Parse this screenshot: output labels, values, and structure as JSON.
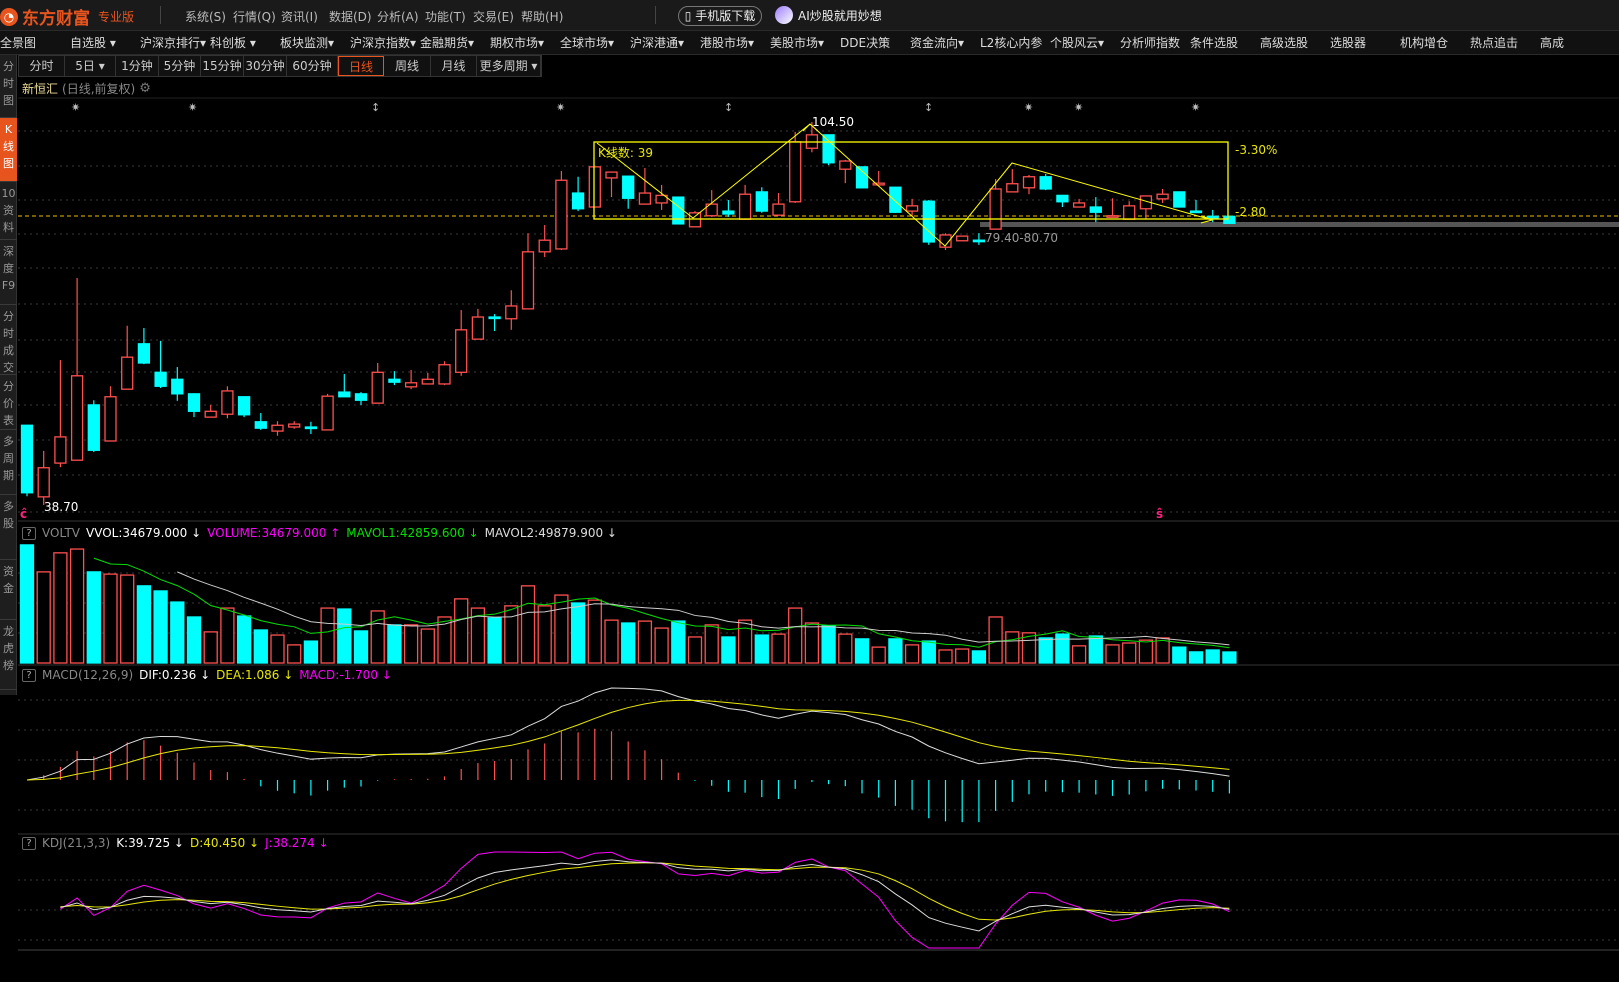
{
  "app": {
    "logo_text": "东方财富",
    "edition": "专业版",
    "mobile_button": "手机版下载",
    "ai_label": "AI炒股就用妙想"
  },
  "menu": [
    "系统(S)",
    "行情(Q)",
    "资讯(I)",
    "数据(D)",
    "分析(A)",
    "功能(T)",
    "交易(E)",
    "帮助(H)"
  ],
  "nav": [
    "全景图",
    "自选股 ▾",
    "沪深京排行▾",
    "科创板 ▾",
    "板块监测▾",
    "沪深京指数▾",
    "金融期货▾",
    "期权市场▾",
    "全球市场▾",
    "沪深港通▾",
    "港股市场▾",
    "美股市场▾",
    "DDE决策",
    "资金流向▾",
    "L2核心内参",
    "个股风云▾",
    "分析师指数",
    "条件选股",
    "高级选股",
    "选股器",
    "机构增仓",
    "热点追击",
    "高成"
  ],
  "sidebar": [
    {
      "label": "分时图"
    },
    {
      "label": "K线图",
      "active": true
    },
    {
      "label": "10资料"
    },
    {
      "label": "深度F9"
    },
    {
      "label": "分时成交"
    },
    {
      "label": "分价表"
    },
    {
      "label": "多周期"
    },
    {
      "label": "多股"
    },
    {
      "label": "资金"
    },
    {
      "label": "龙虎榜"
    }
  ],
  "periods": [
    "分时",
    "5日 ▾",
    "1分钟",
    "5分钟",
    "15分钟",
    "30分钟",
    "60分钟",
    "日线",
    "周线",
    "月线",
    "更多周期 ▾"
  ],
  "active_period": "日线",
  "stock": {
    "name": "新恒汇",
    "mode": "(日线,前复权)"
  },
  "annotations": {
    "high": "104.50",
    "low": "38.70",
    "kline_count": "K线数: 39",
    "pct": "-3.30%",
    "diff": "-2.80",
    "range": "79.40-80.70",
    "marker": "ĉ",
    "marker2": "ŝ"
  },
  "volume_header": {
    "name": "VOLTV",
    "vvol": "VVOL:34679.000 ↓",
    "volume": "VOLUME:34679.000 ↑",
    "mavol1": "MAVOL1:42859.600 ↓",
    "mavol2": "MAVOL2:49879.900 ↓"
  },
  "macd_header": {
    "name": "MACD(12,26,9)",
    "dif": "DIF:0.236 ↓",
    "dea": "DEA:1.086 ↓",
    "macd": "MACD:-1.700 ↓"
  },
  "kdj_header": {
    "name": "KDJ(21,3,3)",
    "k": "K:39.725 ↓",
    "d": "D:40.450 ↓",
    "j": "J:38.274 ↓"
  },
  "help_label": "?",
  "colors": {
    "up": "#ff5050",
    "down": "#00ffff",
    "accent": "#e8541e",
    "annot": "#ffff00",
    "dif": "#dddddd",
    "dea": "#e8e800",
    "j": "#ff00ff",
    "mavol1": "#00e000"
  },
  "chart_data": {
    "type": "candlestick",
    "title": "新恒汇 日线",
    "candles_ohlc": [
      [
        52.4,
        52.4,
        40.2,
        40.8
      ],
      [
        40.1,
        48.0,
        38.7,
        45.1
      ],
      [
        45.9,
        63.6,
        45.2,
        50.4
      ],
      [
        46.4,
        77.7,
        46.4,
        60.9
      ],
      [
        55.9,
        56.7,
        47.8,
        48.1
      ],
      [
        49.7,
        59.1,
        49.7,
        57.3
      ],
      [
        58.6,
        69.5,
        58.6,
        64.1
      ],
      [
        66.4,
        69.1,
        62.9,
        63.1
      ],
      [
        61.5,
        66.9,
        58.8,
        59.1
      ],
      [
        60.3,
        62.4,
        56.6,
        57.8
      ],
      [
        57.8,
        57.9,
        53.8,
        54.8
      ],
      [
        53.8,
        55.9,
        53.8,
        54.8
      ],
      [
        54.3,
        59.1,
        53.6,
        58.3
      ],
      [
        57.3,
        57.3,
        53.8,
        54.2
      ],
      [
        53.0,
        54.5,
        51.6,
        51.9
      ],
      [
        51.4,
        53.1,
        50.6,
        52.4
      ],
      [
        52.1,
        53.1,
        51.8,
        52.6
      ],
      [
        52.1,
        53.0,
        50.9,
        51.9
      ],
      [
        51.6,
        57.8,
        51.6,
        57.4
      ],
      [
        58.1,
        61.2,
        57.3,
        57.3
      ],
      [
        57.8,
        58.1,
        55.9,
        56.7
      ],
      [
        56.2,
        63.1,
        56.2,
        61.5
      ],
      [
        60.3,
        61.7,
        59.3,
        59.8
      ],
      [
        59.0,
        61.9,
        58.6,
        59.7
      ],
      [
        59.5,
        61.4,
        59.5,
        60.3
      ],
      [
        59.5,
        63.4,
        59.3,
        62.8
      ],
      [
        61.5,
        72.2,
        60.9,
        68.8
      ],
      [
        67.2,
        72.4,
        67.2,
        71.0
      ],
      [
        71.0,
        71.5,
        68.6,
        70.8
      ],
      [
        70.7,
        75.6,
        68.8,
        72.9
      ],
      [
        72.4,
        85.4,
        72.4,
        82.2
      ],
      [
        82.2,
        86.8,
        81.3,
        84.2
      ],
      [
        82.7,
        96.1,
        82.5,
        94.5
      ],
      [
        92.3,
        95.1,
        89.2,
        89.6
      ],
      [
        89.9,
        96.8,
        89.9,
        96.8
      ],
      [
        94.9,
        95.9,
        91.6,
        95.9
      ],
      [
        95.2,
        95.2,
        89.6,
        91.4
      ],
      [
        90.4,
        96.6,
        90.4,
        92.3
      ],
      [
        90.6,
        93.7,
        89.4,
        91.9
      ],
      [
        91.6,
        91.6,
        87.0,
        87.0
      ],
      [
        86.5,
        89.2,
        86.5,
        88.9
      ],
      [
        88.4,
        92.8,
        88.2,
        90.4
      ],
      [
        89.2,
        91.1,
        88.2,
        88.7
      ],
      [
        87.8,
        93.7,
        87.7,
        92.1
      ],
      [
        92.5,
        93.3,
        88.9,
        89.2
      ],
      [
        88.5,
        92.3,
        88.5,
        90.4
      ],
      [
        90.8,
        102.8,
        90.6,
        101.1
      ],
      [
        100.0,
        104.5,
        99.3,
        102.3
      ],
      [
        102.3,
        102.3,
        97.1,
        97.5
      ],
      [
        96.4,
        98.0,
        94.0,
        97.8
      ],
      [
        96.8,
        96.8,
        93.2,
        93.2
      ],
      [
        93.7,
        96.1,
        93.7,
        94.0
      ],
      [
        93.3,
        93.3,
        88.9,
        89.0
      ],
      [
        89.2,
        91.3,
        88.3,
        90.1
      ],
      [
        90.9,
        91.1,
        83.4,
        83.9
      ],
      [
        83.0,
        85.4,
        82.5,
        85.1
      ],
      [
        84.1,
        84.9,
        84.1,
        84.9
      ],
      [
        84.2,
        85.4,
        83.4,
        84.1
      ],
      [
        86.1,
        94.7,
        86.1,
        93.0
      ],
      [
        92.5,
        96.4,
        92.5,
        93.9
      ],
      [
        93.2,
        95.4,
        92.1,
        95.1
      ],
      [
        95.1,
        95.6,
        92.8,
        93.0
      ],
      [
        91.9,
        91.9,
        89.9,
        90.8
      ],
      [
        89.9,
        91.3,
        89.9,
        90.6
      ],
      [
        89.9,
        91.6,
        87.3,
        89.0
      ],
      [
        88.2,
        91.4,
        88.2,
        88.4
      ],
      [
        87.8,
        90.9,
        87.8,
        90.1
      ],
      [
        89.6,
        91.8,
        87.8,
        91.8
      ],
      [
        91.3,
        93.0,
        90.6,
        92.1
      ],
      [
        92.5,
        92.5,
        89.9,
        89.9
      ],
      [
        89.2,
        91.1,
        88.9,
        89.0
      ],
      [
        88.3,
        89.4,
        87.3,
        88.2
      ],
      [
        88.3,
        88.3,
        87.1,
        87.1
      ]
    ],
    "volume": [
      372000,
      287000,
      347000,
      359000,
      287000,
      280000,
      277000,
      243000,
      227000,
      192000,
      145000,
      98000,
      173000,
      148000,
      104000,
      88000,
      57000,
      69000,
      173000,
      170000,
      101000,
      164000,
      120000,
      120000,
      107000,
      145000,
      202000,
      173000,
      142000,
      180000,
      243000,
      180000,
      214000,
      189000,
      198000,
      135000,
      126000,
      132000,
      110000,
      132000,
      82000,
      120000,
      82000,
      135000,
      88000,
      91000,
      173000,
      126000,
      117000,
      91000,
      76000,
      50000,
      76000,
      57000,
      69000,
      41000,
      44000,
      38000,
      145000,
      98000,
      95000,
      79000,
      91000,
      54000,
      85000,
      57000,
      63000,
      72000,
      79000,
      50000,
      35000,
      41000,
      34679
    ],
    "price_range": [
      38.7,
      104.5
    ],
    "indicators": [
      "VOLTV",
      "MACD(12,26,9)",
      "KDJ(21,3,3)"
    ]
  }
}
